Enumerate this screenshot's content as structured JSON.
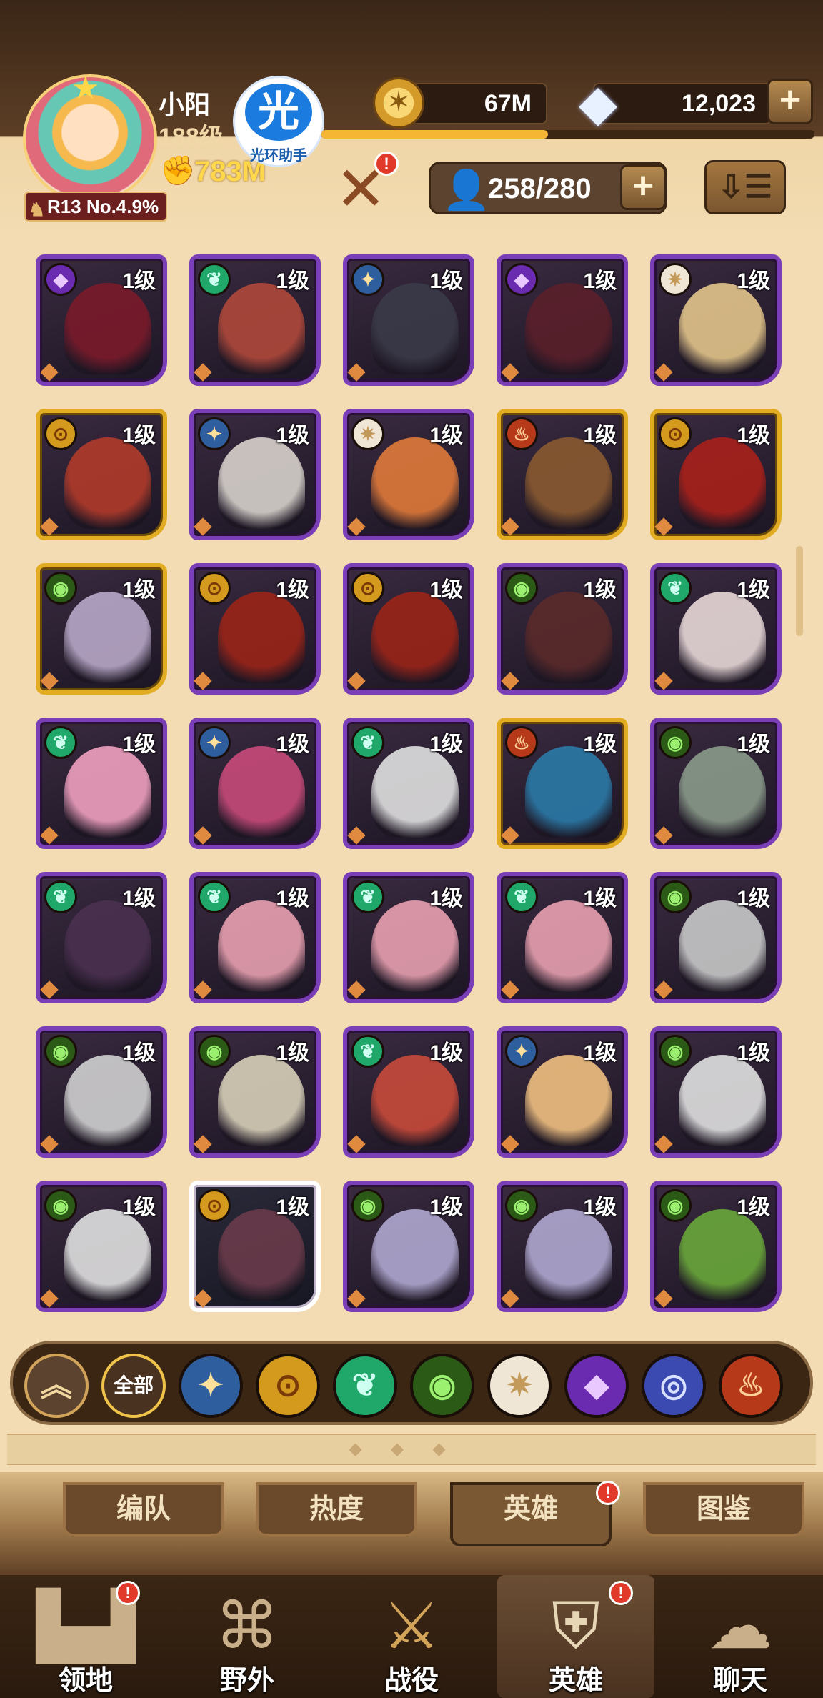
{
  "header": {
    "player_name": "小阳",
    "player_level": "188级",
    "power": "783M",
    "rank": "R13 No.4.9%",
    "overlay_badge_text": "光环助手",
    "overlay_badge_glyph": "光",
    "gold": "67M",
    "gems": "12,023",
    "xp_progress": 0.46,
    "hero_count": "258/280"
  },
  "heroes": [
    {
      "faction": "hypogean",
      "level": "1级",
      "frame": "mythic",
      "portrait": "#7a1a2a"
    },
    {
      "faction": "wilder",
      "level": "1级",
      "frame": "mythic",
      "portrait": "#b0483a"
    },
    {
      "faction": "lightbearer",
      "level": "1级",
      "frame": "mythic",
      "portrait": "#3a3a48"
    },
    {
      "faction": "hypogean",
      "level": "1级",
      "frame": "mythic",
      "portrait": "#5a1f2a"
    },
    {
      "faction": "celestial",
      "level": "1级",
      "frame": "mythic",
      "portrait": "#e3c58a"
    },
    {
      "faction": "mauler",
      "level": "1级",
      "frame": "legendary",
      "portrait": "#b03a2a"
    },
    {
      "faction": "lightbearer",
      "level": "1级",
      "frame": "mythic",
      "portrait": "#d8d2cc"
    },
    {
      "faction": "celestial",
      "level": "1级",
      "frame": "mythic",
      "portrait": "#e07a3a"
    },
    {
      "faction": "brutal",
      "level": "1级",
      "frame": "legendary",
      "portrait": "#8a5a30"
    },
    {
      "faction": "mauler",
      "level": "1级",
      "frame": "legendary",
      "portrait": "#a8201a"
    },
    {
      "faction": "graveborn",
      "level": "1级",
      "frame": "legendary",
      "portrait": "#b8a8c8"
    },
    {
      "faction": "mauler",
      "level": "1级",
      "frame": "mythic",
      "portrait": "#9a2418"
    },
    {
      "faction": "mauler",
      "level": "1级",
      "frame": "mythic",
      "portrait": "#9a2418"
    },
    {
      "faction": "graveborn",
      "level": "1级",
      "frame": "mythic",
      "portrait": "#5a2a2a"
    },
    {
      "faction": "wilder",
      "level": "1级",
      "frame": "mythic",
      "portrait": "#e8d8d8"
    },
    {
      "faction": "wilder",
      "level": "1级",
      "frame": "mythic",
      "portrait": "#f0a0c0"
    },
    {
      "faction": "lightbearer",
      "level": "1级",
      "frame": "mythic",
      "portrait": "#c84a7a"
    },
    {
      "faction": "wilder",
      "level": "1级",
      "frame": "mythic",
      "portrait": "#e0e0e0"
    },
    {
      "faction": "brutal",
      "level": "1级",
      "frame": "legendary",
      "portrait": "#2a7aa8"
    },
    {
      "faction": "graveborn",
      "level": "1级",
      "frame": "mythic",
      "portrait": "#8a9a8a"
    },
    {
      "faction": "wilder",
      "level": "1级",
      "frame": "mythic",
      "portrait": "#4a3050"
    },
    {
      "faction": "wilder",
      "level": "1级",
      "frame": "mythic",
      "portrait": "#e8a0b0"
    },
    {
      "faction": "wilder",
      "level": "1级",
      "frame": "mythic",
      "portrait": "#e8a0b0"
    },
    {
      "faction": "wilder",
      "level": "1级",
      "frame": "mythic",
      "portrait": "#e8a0b0"
    },
    {
      "faction": "graveborn",
      "level": "1级",
      "frame": "mythic",
      "portrait": "#c8c8c8"
    },
    {
      "faction": "graveborn",
      "level": "1级",
      "frame": "mythic",
      "portrait": "#d0d0d0"
    },
    {
      "faction": "graveborn",
      "level": "1级",
      "frame": "mythic",
      "portrait": "#d8d0b8"
    },
    {
      "faction": "wilder",
      "level": "1级",
      "frame": "mythic",
      "portrait": "#c84a3a"
    },
    {
      "faction": "lightbearer",
      "level": "1级",
      "frame": "mythic",
      "portrait": "#f0c080"
    },
    {
      "faction": "graveborn",
      "level": "1级",
      "frame": "mythic",
      "portrait": "#e0e0e0"
    },
    {
      "faction": "graveborn",
      "level": "1级",
      "frame": "mythic",
      "portrait": "#e0e0e0"
    },
    {
      "faction": "mauler",
      "level": "1级",
      "frame": "white",
      "portrait": "#6a3a4a"
    },
    {
      "faction": "graveborn",
      "level": "1级",
      "frame": "mythic",
      "portrait": "#b0a8d0"
    },
    {
      "faction": "graveborn",
      "level": "1级",
      "frame": "mythic",
      "portrait": "#b0a8d0"
    },
    {
      "faction": "graveborn",
      "level": "1级",
      "frame": "mythic",
      "portrait": "#6aa83a"
    }
  ],
  "filters": {
    "all_label": "全部",
    "icons": [
      "collapse-icon",
      "all",
      "lightbearer-icon",
      "mauler-icon",
      "wilder-icon",
      "graveborn-icon",
      "celestial-icon",
      "hypogean-icon",
      "dimensional-icon",
      "brutal-icon"
    ]
  },
  "subtabs": [
    {
      "label": "编队",
      "active": false
    },
    {
      "label": "热度",
      "active": false
    },
    {
      "label": "英雄",
      "active": true
    },
    {
      "label": "图鉴",
      "active": false
    }
  ],
  "nav": [
    {
      "label": "领地",
      "icon": "castle-icon"
    },
    {
      "label": "野外",
      "icon": "map-scroll-icon"
    },
    {
      "label": "战役",
      "icon": "sword-shield-icon"
    },
    {
      "label": "英雄",
      "icon": "hero-helmet-icon"
    },
    {
      "label": "聊天",
      "icon": "chat-bubble-icon"
    }
  ],
  "badge_text": "!",
  "glyphs": {
    "power": "✊",
    "gold": "✶",
    "gem": "◆",
    "plus": "+",
    "person": "👤",
    "sort": "⇩☰",
    "resonance": "✕",
    "rank": "♞",
    "avatar_star": "★",
    "collapse": "︽",
    "deco": "◆◆◆"
  }
}
